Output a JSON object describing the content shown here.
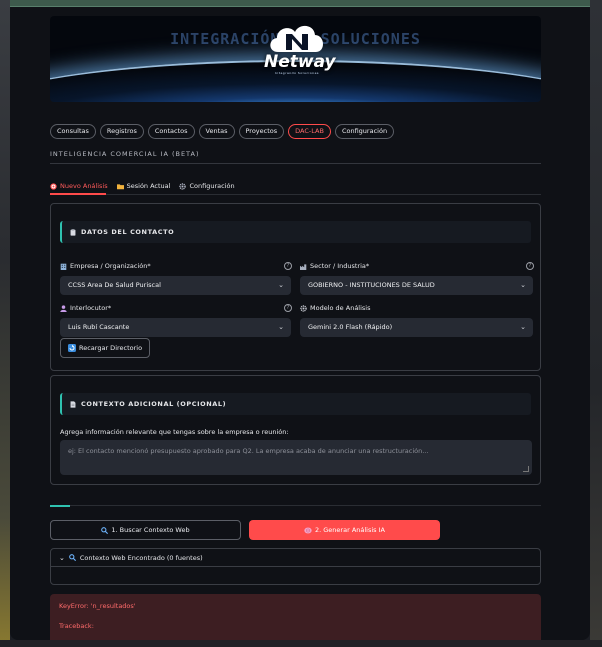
{
  "banner": {
    "watermark": "INTEGRACIÓN DE SOLUCIONES",
    "logo_text": "Netway",
    "logo_subtitle": "Integrando Soluciones"
  },
  "nav": {
    "items": [
      {
        "label": "Consultas",
        "active": false
      },
      {
        "label": "Registros",
        "active": false
      },
      {
        "label": "Contactos",
        "active": false
      },
      {
        "label": "Ventas",
        "active": false
      },
      {
        "label": "Proyectos",
        "active": false
      },
      {
        "label": "DAC-LAB",
        "active": true
      },
      {
        "label": "Configuración",
        "active": false
      }
    ]
  },
  "section_title": "INTELIGENCIA COMERCIAL IA (BETA)",
  "subtabs": {
    "new_analysis": "Nuevo Análisis",
    "current_session": "Sesión Actual",
    "settings": "Configuración"
  },
  "contact_card": {
    "title": "DATOS DEL CONTACTO",
    "company_label": "Empresa / Organización*",
    "company_value": "CCSS Area De Salud Puriscal",
    "sector_label": "Sector / Industria*",
    "sector_value": "GOBIERNO - INSTITUCIONES DE SALUD",
    "contact_label": "Interlocutor*",
    "contact_value": "Luis Rubí Cascante",
    "model_label": "Modelo de Análisis",
    "model_value": "Gemini 2.0 Flash (Rápido)",
    "reload_button": "Recargar Directorio"
  },
  "context_card": {
    "title": "CONTEXTO ADICIONAL (OPCIONAL)",
    "instruction": "Agrega información relevante que tengas sobre la empresa o reunión:",
    "placeholder": "ej: El contacto mencionó presupuesto aprobado para Q2. La empresa acaba de anunciar una restructuración..."
  },
  "actions": {
    "search_button": "1. Buscar Contexto Web",
    "generate_button": "2. Generar Análisis IA"
  },
  "expander": {
    "title": "Contexto Web Encontrado (0 fuentes)"
  },
  "error": {
    "message": "KeyError: 'n_resultados'",
    "traceback": "Traceback:"
  },
  "colors": {
    "accent": "#ff4b4b",
    "teal": "#2fc2b0",
    "background": "#0f1116",
    "input_bg": "#262a33"
  }
}
